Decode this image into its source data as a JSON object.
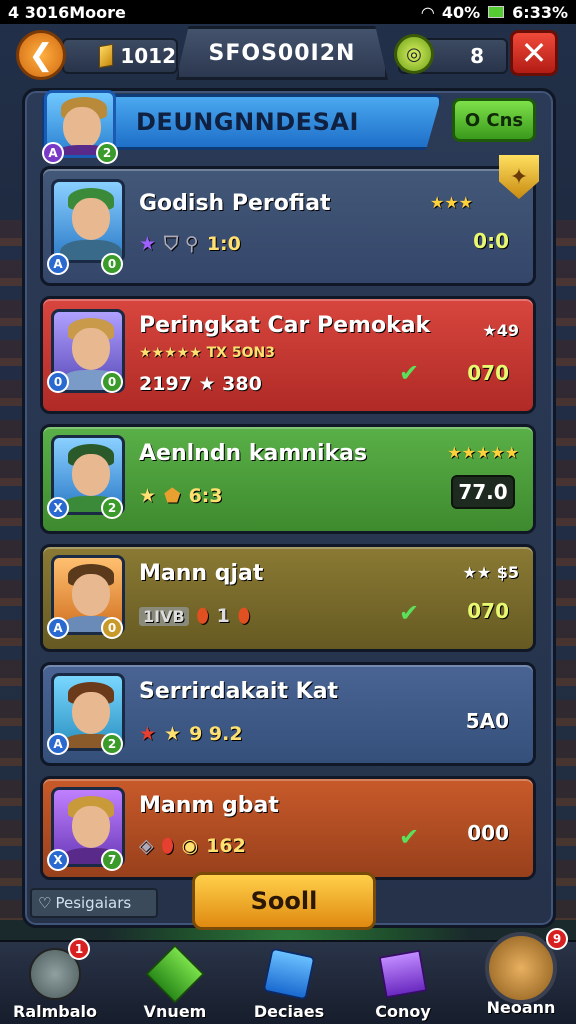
{
  "status_bar": {
    "left": "4 3016Moore",
    "battery": "40%",
    "time": "6:33%"
  },
  "top_bar": {
    "gold": "1012",
    "title": "SFOS00I2N",
    "coins": "8",
    "back_glyph": "❮",
    "close_glyph": "✕"
  },
  "header": {
    "title": "DEUNGNNDESAI",
    "button_label": "O Cns",
    "badge_left": "A",
    "badge_right": "2"
  },
  "rows": [
    {
      "name": "Godish Perofiat",
      "stat_text": "1:0",
      "stars": "★★★",
      "score": "0:0",
      "color": "#3a4c6e",
      "badge_a": "A",
      "badge_b": "0"
    },
    {
      "name": "Peringkat Car Pemokak",
      "line2": "★★★★★ TX 5ON3",
      "stat_text": "2197 ★ 380",
      "stars": "★49",
      "score": "070",
      "color": "#c23a34",
      "badge_a": "0",
      "badge_b": "0"
    },
    {
      "name": "Aenlndn kamnikas",
      "stat_text": "6:3",
      "stars": "★★★★★",
      "score": "77.0",
      "color": "#4a9a3a",
      "badge_a": "X",
      "badge_b": "2"
    },
    {
      "name": "Mann qjat",
      "stat_text": "1",
      "stat_prefix": "1IVB",
      "stars": "★★ $5",
      "score": "070",
      "color": "#7a6a2a",
      "badge_a": "A",
      "badge_b": "0"
    },
    {
      "name": "Serrirdakait Kat",
      "stat_text": "9 9.2",
      "stars": "",
      "score": "5A0",
      "color": "#34507a",
      "badge_a": "A",
      "badge_b": "2"
    },
    {
      "name": "Manm gbat",
      "stat_text": "162",
      "stars": "",
      "score": "000",
      "color": "#b04a24",
      "badge_a": "X",
      "badge_b": "7"
    }
  ],
  "footer": {
    "label": "Pesigaiars",
    "submit": "Sooll"
  },
  "nav": [
    {
      "label": "Ralmbalo",
      "badge": "1"
    },
    {
      "label": "Vnuem",
      "badge": ""
    },
    {
      "label": "Deciaes",
      "badge": ""
    },
    {
      "label": "Conoy",
      "badge": ""
    },
    {
      "label": "Neoann",
      "badge": "9"
    }
  ]
}
